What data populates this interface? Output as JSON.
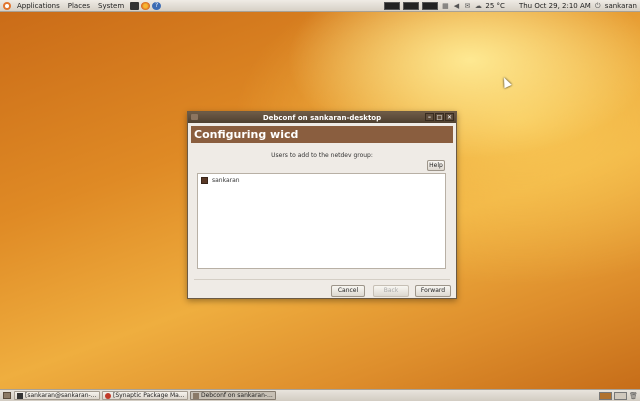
{
  "top_panel": {
    "menus": [
      "Applications",
      "Places",
      "System"
    ],
    "temperature": "25 °C",
    "clock": "Thu Oct 29,  2:10 AM",
    "user": "sankaran"
  },
  "dialog": {
    "title": "Debconf on sankaran-desktop",
    "heading": "Configuring wicd",
    "prompt": "Users to add to the netdev group:",
    "help_label": "Help",
    "list_items": [
      "sankaran"
    ],
    "cancel_label": "Cancel",
    "back_label": "Back",
    "forward_label": "Forward"
  },
  "taskbar": {
    "tasks": [
      "[sankaran@sankaran-...",
      "[Synaptic Package Ma...",
      "Debconf on sankaran-..."
    ]
  },
  "colors": {
    "banner": "#8a5e3f",
    "titlebar": "#4f4030",
    "desktop": "#df8a25"
  }
}
